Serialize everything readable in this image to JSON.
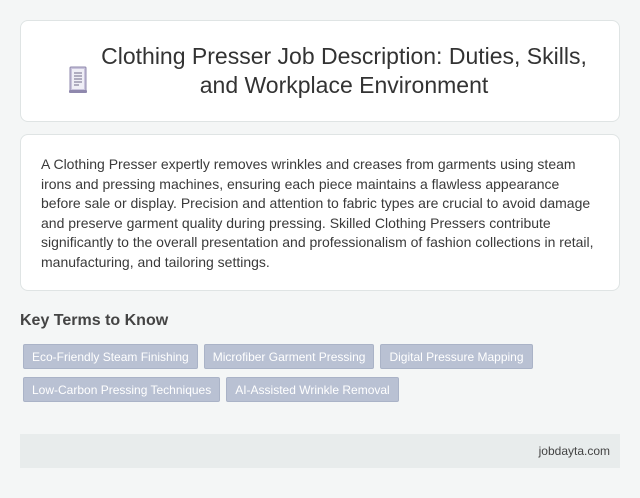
{
  "header": {
    "icon": "document-icon",
    "title": "Clothing Presser Job Description: Duties, Skills, and Workplace Environment"
  },
  "description": {
    "text": "A Clothing Presser expertly removes wrinkles and creases from garments using steam irons and pressing machines, ensuring each piece maintains a flawless appearance before sale or display. Precision and attention to fabric types are crucial to avoid damage and preserve garment quality during pressing. Skilled Clothing Pressers contribute significantly to the overall presentation and professionalism of fashion collections in retail, manufacturing, and tailoring settings."
  },
  "key_terms": {
    "heading": "Key Terms to Know",
    "tags": [
      "Eco-Friendly Steam Finishing",
      "Microfiber Garment Pressing",
      "Digital Pressure Mapping",
      "Low-Carbon Pressing Techniques",
      "AI-Assisted Wrinkle Removal"
    ]
  },
  "footer": {
    "site": "jobdayta.com"
  },
  "colors": {
    "tag_background": "#b9c1d3",
    "footer_background": "#e8ecec",
    "page_background": "#f4f6f6"
  }
}
